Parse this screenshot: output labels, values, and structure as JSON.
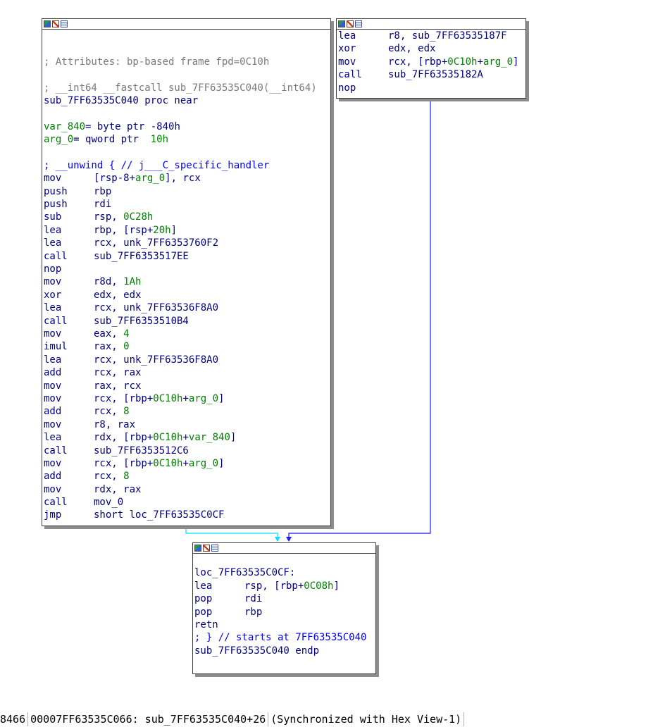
{
  "blocks": {
    "entry": {
      "lines": [
        {
          "kind": "blank"
        },
        {
          "kind": "blank"
        },
        {
          "kind": "comment",
          "text": "; Attributes: bp-based frame fpd=0C10h"
        },
        {
          "kind": "blank"
        },
        {
          "kind": "comment",
          "text": "; __int64 __fastcall sub_7FF63535C040(__int64)"
        },
        {
          "kind": "label",
          "text": "sub_7FF63535C040 proc near"
        },
        {
          "kind": "blank"
        },
        {
          "kind": "label",
          "text": "var_840= byte ptr -840h"
        },
        {
          "kind": "label",
          "text": "arg_0= qword ptr  10h"
        },
        {
          "kind": "blank"
        },
        {
          "kind": "blue",
          "text": "; __unwind { // j___C_specific_handler"
        },
        {
          "kind": "ins",
          "m": "mov",
          "o": "[rsp-8+arg_0], rcx"
        },
        {
          "kind": "ins",
          "m": "push",
          "o": "rbp"
        },
        {
          "kind": "ins",
          "m": "push",
          "o": "rdi"
        },
        {
          "kind": "ins",
          "m": "sub",
          "o": "rsp, 0C28h"
        },
        {
          "kind": "ins",
          "m": "lea",
          "o": "rbp, [rsp+20h]"
        },
        {
          "kind": "ins",
          "m": "lea",
          "o": "rcx, unk_7FF6353760F2"
        },
        {
          "kind": "ins",
          "m": "call",
          "o": "sub_7FF6353517EE"
        },
        {
          "kind": "ins",
          "m": "nop",
          "o": ""
        },
        {
          "kind": "ins",
          "m": "mov",
          "o": "r8d, 1Ah"
        },
        {
          "kind": "ins",
          "m": "xor",
          "o": "edx, edx"
        },
        {
          "kind": "ins",
          "m": "lea",
          "o": "rcx, unk_7FF63536F8A0"
        },
        {
          "kind": "ins",
          "m": "call",
          "o": "sub_7FF6353510B4"
        },
        {
          "kind": "ins",
          "m": "mov",
          "o": "eax, 4"
        },
        {
          "kind": "ins",
          "m": "imul",
          "o": "rax, 0"
        },
        {
          "kind": "ins",
          "m": "lea",
          "o": "rcx, unk_7FF63536F8A0"
        },
        {
          "kind": "ins",
          "m": "add",
          "o": "rcx, rax"
        },
        {
          "kind": "ins",
          "m": "mov",
          "o": "rax, rcx"
        },
        {
          "kind": "ins",
          "m": "mov",
          "o": "rcx, [rbp+0C10h+arg_0]"
        },
        {
          "kind": "ins",
          "m": "add",
          "o": "rcx, 8"
        },
        {
          "kind": "ins",
          "m": "mov",
          "o": "r8, rax"
        },
        {
          "kind": "ins",
          "m": "lea",
          "o": "rdx, [rbp+0C10h+var_840]"
        },
        {
          "kind": "ins",
          "m": "call",
          "o": "sub_7FF6353512C6"
        },
        {
          "kind": "ins",
          "m": "mov",
          "o": "rcx, [rbp+0C10h+arg_0]"
        },
        {
          "kind": "ins",
          "m": "add",
          "o": "rcx, 8"
        },
        {
          "kind": "ins",
          "m": "mov",
          "o": "rdx, rax"
        },
        {
          "kind": "ins",
          "m": "call",
          "o": "mov_0"
        },
        {
          "kind": "ins",
          "m": "jmp",
          "o": "short loc_7FF63535C0CF"
        }
      ]
    },
    "handler": {
      "lines": [
        {
          "kind": "ins",
          "m": "lea",
          "o": "r8, sub_7FF63535187F"
        },
        {
          "kind": "ins",
          "m": "xor",
          "o": "edx, edx"
        },
        {
          "kind": "ins",
          "m": "mov",
          "o": "rcx, [rbp+0C10h+arg_0]"
        },
        {
          "kind": "ins",
          "m": "call",
          "o": "sub_7FF63535182A"
        },
        {
          "kind": "ins",
          "m": "nop",
          "o": ""
        }
      ]
    },
    "exit": {
      "lines": [
        {
          "kind": "blank"
        },
        {
          "kind": "label",
          "text": "loc_7FF63535C0CF:"
        },
        {
          "kind": "ins",
          "m": "lea",
          "o": "rsp, [rbp+0C08h]"
        },
        {
          "kind": "ins",
          "m": "pop",
          "o": "rdi"
        },
        {
          "kind": "ins",
          "m": "pop",
          "o": "rbp"
        },
        {
          "kind": "ins",
          "m": "retn",
          "o": ""
        },
        {
          "kind": "blue",
          "text": "; } // starts at 7FF63535C040"
        },
        {
          "kind": "label",
          "text": "sub_7FF63535C040 endp"
        }
      ]
    }
  },
  "status": {
    "position": "8466",
    "location": "00007FF63535C066: sub_7FF63535C040+26",
    "sync": "(Synchronized with Hex View-1)"
  },
  "colors": {
    "edge_normal": "#00e0ff",
    "edge_jump": "#1a1aff",
    "operand_number": "#008000",
    "name_text": "#000080"
  }
}
